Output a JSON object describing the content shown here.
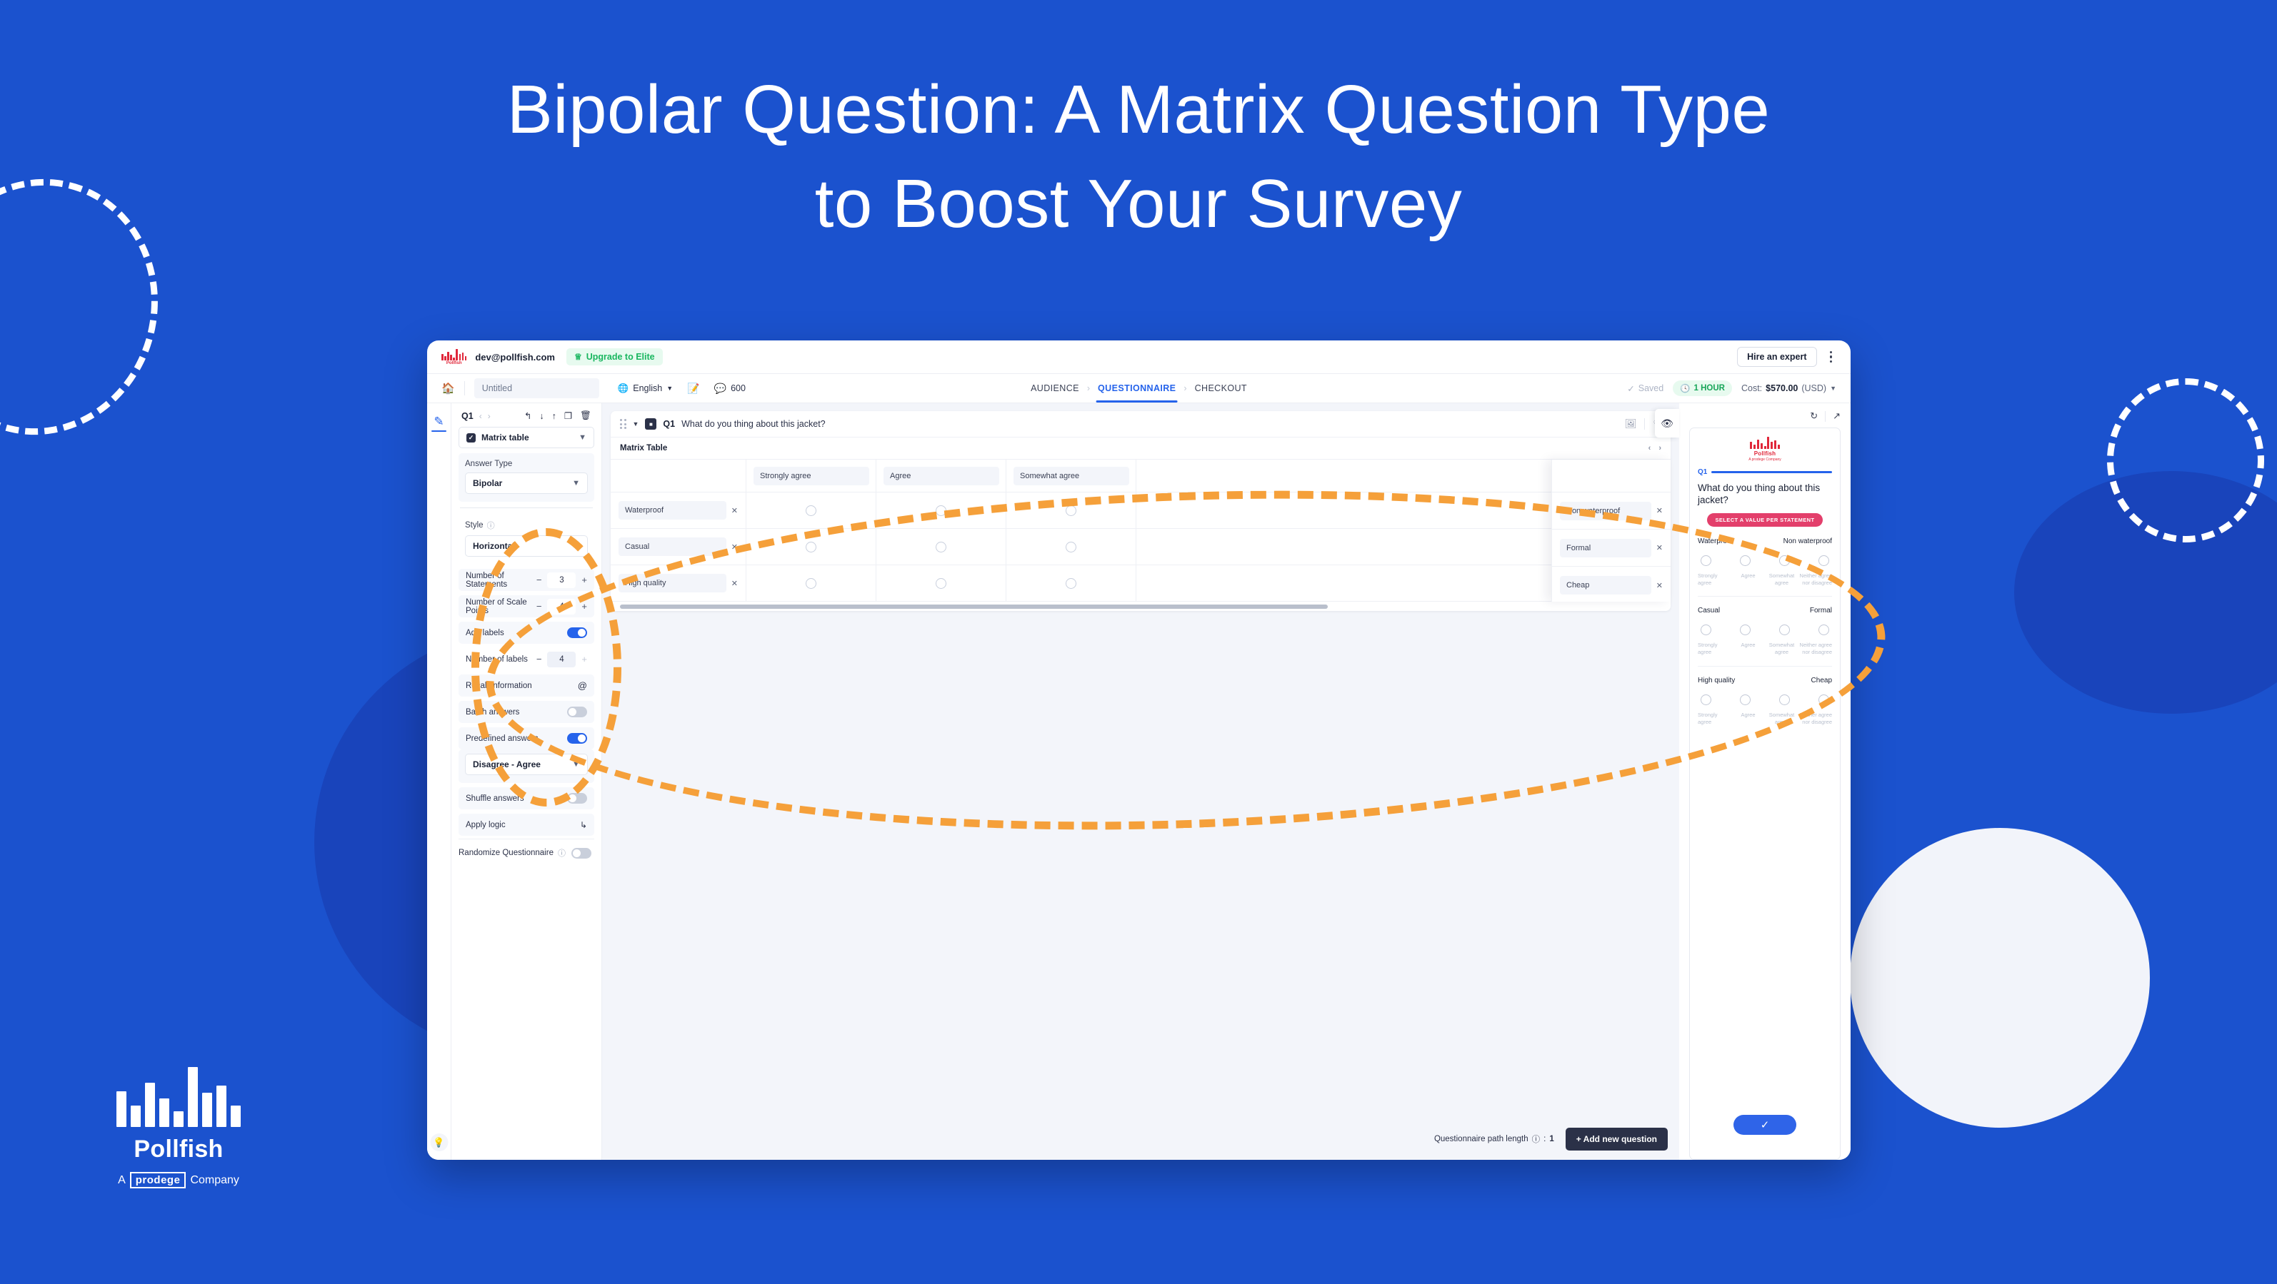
{
  "headline": {
    "line1": "Bipolar Question: A Matrix Question Type",
    "line2": "to Boost Your Survey"
  },
  "brand": {
    "name": "Pollfish",
    "tagline_a": "A",
    "tagline_b": "prodege",
    "tagline_c": "Company"
  },
  "colors": {
    "background_blue": "#1b52ce",
    "accent_blue": "#2563eb",
    "brand_red": "#e0273a",
    "dashed_orange": "#f5a03a",
    "chip_pink": "#e33f6b",
    "success_green": "#17a558"
  },
  "app": {
    "topbar": {
      "logo_word": "Pollfish",
      "account_email": "dev@pollfish.com",
      "upgrade_label": "Upgrade to Elite",
      "upgrade_icon": "crown-icon",
      "hire_label": "Hire an expert",
      "kebab_icon": "more-vertical-icon"
    },
    "subbar": {
      "home_icon": "home-icon",
      "survey_title": "Untitled",
      "survey_title_placeholder": "Untitled",
      "language": "English",
      "edit_icon": "edit-note-icon",
      "responses_icon": "responses-icon",
      "responses_count": "600",
      "tabs": [
        {
          "label": "AUDIENCE",
          "active": false
        },
        {
          "label": "QUESTIONNAIRE",
          "active": true
        },
        {
          "label": "CHECKOUT",
          "active": false
        }
      ],
      "saved_label": "Saved",
      "saved_icon": "check-circle-icon",
      "duration_label": "1 HOUR",
      "duration_icon": "clock-icon",
      "cost_label": "Cost:",
      "cost_value": "$570.00",
      "cost_currency": "(USD)"
    },
    "rail": {
      "pen_icon": "pencil-icon",
      "bulb_icon": "lightbulb-icon"
    },
    "panel": {
      "question_number": "Q1",
      "prev_icon": "chevron-left-icon",
      "next_icon": "chevron-right-icon",
      "tool_icons": [
        "undo-icon",
        "move-down-icon",
        "move-up-icon",
        "copy-icon",
        "trash-icon"
      ],
      "question_type": "Matrix table",
      "answer_type_label": "Answer Type",
      "answer_type_value": "Bipolar",
      "style_label": "Style",
      "style_value": "Horizontal",
      "num_statements_label": "Number of Statements",
      "num_statements_value": "3",
      "num_scale_points_label": "Number of Scale Points",
      "num_scale_points_value": "4",
      "add_labels_label": "Add labels",
      "add_labels_on": true,
      "num_labels_label": "Number of labels",
      "num_labels_value": "4",
      "recall_label": "Recall Information",
      "recall_icon": "at-icon",
      "batch_label": "Batch answers",
      "batch_on": false,
      "predefined_label": "Predefined answers",
      "predefined_on": true,
      "predefined_value": "Disagree - Agree",
      "shuffle_label": "Shuffle answers",
      "shuffle_on": false,
      "apply_logic_label": "Apply logic",
      "apply_logic_icon": "branch-icon",
      "randomize_label": "Randomize Questionnaire",
      "randomize_on": false
    },
    "canvas": {
      "question_label": "Q1",
      "question_text": "What do you thing about this jacket?",
      "drag_icon": "drag-handle-icon",
      "collapse_icon": "caret-down-icon",
      "type_icon": "matrix-icon",
      "image_icon": "image-icon",
      "favorite_icon": "heart-icon",
      "preview_eye_icon": "eye-icon",
      "table_title": "Matrix Table",
      "table_prev_icon": "chevron-left-icon",
      "table_next_icon": "chevron-right-icon",
      "scale_columns": [
        "Strongly agree",
        "Agree",
        "Somewhat agree"
      ],
      "left_statements": [
        "Waterproof",
        "Casual",
        "High quality"
      ],
      "right_statements": [
        "Non waterproof",
        "Formal",
        "Cheap"
      ],
      "remove_icon": "close-icon",
      "path_length_label": "Questionnaire path length",
      "path_length_info_icon": "info-icon",
      "path_length_value": "1",
      "add_question_label": "+ Add new question"
    },
    "preview": {
      "refresh_icon": "refresh-icon",
      "open_external_icon": "external-link-icon",
      "logo_word": "Pollfish",
      "logo_sub": "A prodege Company",
      "question_label": "Q1",
      "question_text": "What do you thing about this jacket?",
      "instruction_chip": "SELECT A VALUE PER STATEMENT",
      "scale_labels": [
        "Strongly agree",
        "Agree",
        "Somewhat agree",
        "Neither agree nor disagree"
      ],
      "statements": [
        {
          "left": "Waterproof",
          "right": "Non waterproof"
        },
        {
          "left": "Casual",
          "right": "Formal"
        },
        {
          "left": "High quality",
          "right": "Cheap"
        }
      ],
      "submit_icon": "check-icon"
    }
  }
}
